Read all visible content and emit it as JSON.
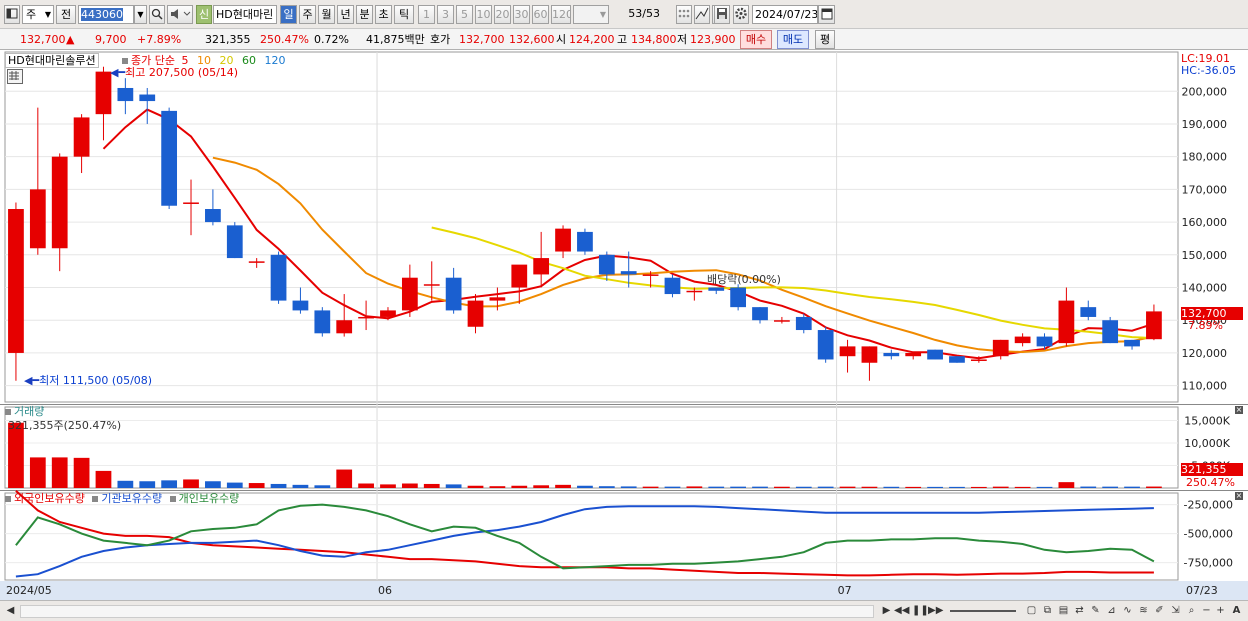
{
  "toolbar": {
    "market": "주",
    "prev": "전",
    "code": "443060",
    "new_badge": "신",
    "name": "HD현대마린",
    "periods": [
      "일",
      "주",
      "월",
      "년",
      "분",
      "초",
      "틱"
    ],
    "active_period": "일",
    "intervals": [
      "1",
      "3",
      "5",
      "10",
      "20",
      "30",
      "60",
      "120"
    ],
    "count": "53",
    "count_total": "/53",
    "date": "2024/07/23"
  },
  "quote": {
    "price": "132,700",
    "change": "9,700",
    "change_arrow": "▲",
    "change_pct": "+7.89%",
    "volume": "321,355",
    "volume_ratio": "250.47%",
    "turnover_pct": "0.72%",
    "amount": "41,875백만",
    "hoga_label": "호가",
    "ask": "132,700",
    "bid": "132,600",
    "open_label": "시",
    "open": "124,200",
    "high_label": "고",
    "high": "134,800",
    "low_label": "저",
    "low": "123,900",
    "buy_button": "매수",
    "sell_button": "매도",
    "eval_button": "평"
  },
  "chart": {
    "title": "HD현대마린솔루션",
    "ma_label": "종가 단순",
    "ma_periods": [
      {
        "label": "5",
        "color": "#e60000"
      },
      {
        "label": "10",
        "color": "#f08a00"
      },
      {
        "label": "20",
        "color": "#e6d800"
      },
      {
        "label": "60",
        "color": "#1a8a1a"
      },
      {
        "label": "120",
        "color": "#1a7ad0"
      }
    ],
    "lc": "LC:19.01",
    "hc": "HC:-36.05",
    "high_note": "최고 207,500 (05/14)",
    "low_note": "최저 111,500 (05/08)",
    "dividend_note": "배당락(0.00%)",
    "last_price_tag": "132,700",
    "last_pct_tag": "7.89%",
    "price_ticks": [
      "200,000",
      "190,000",
      "180,000",
      "170,000",
      "160,000",
      "150,000",
      "140,000",
      "130,000",
      "120,000",
      "110,000"
    ],
    "volume_title": "거래량",
    "volume_note": "321,355주(250.47%)",
    "volume_ticks": [
      "15,000K",
      "10,000K",
      "5,000K"
    ],
    "volume_tag": "321,355",
    "volume_pct_tag": "250.47%",
    "holding_legend": [
      {
        "label": "외국인보유수량",
        "color": "#e60000"
      },
      {
        "label": "기관보유수량",
        "color": "#1a50d0"
      },
      {
        "label": "개인보유수량",
        "color": "#2a8a3a"
      }
    ],
    "holding_ticks": [
      "-250,000",
      "-500,000",
      "-750,000"
    ],
    "x_labels": [
      "2024/05",
      "06",
      "07"
    ],
    "x_last_label": "07/23"
  },
  "colors": {
    "up": "#e60000",
    "down": "#1a5fd0",
    "ma5": "#e60000",
    "ma10": "#f08a00",
    "ma20": "#e6d800"
  },
  "chart_data": {
    "type": "candlestick",
    "price_ylim": [
      105000,
      212000
    ],
    "candles": [
      {
        "o": 120000,
        "h": 166000,
        "l": 111500,
        "c": 164000
      },
      {
        "o": 152000,
        "h": 195000,
        "l": 150000,
        "c": 170000
      },
      {
        "o": 152000,
        "h": 181000,
        "l": 145000,
        "c": 180000
      },
      {
        "o": 180000,
        "h": 193000,
        "l": 175000,
        "c": 192000
      },
      {
        "o": 193000,
        "h": 207500,
        "l": 185000,
        "c": 206000
      },
      {
        "o": 201000,
        "h": 204000,
        "l": 193000,
        "c": 197000
      },
      {
        "o": 199000,
        "h": 201000,
        "l": 190000,
        "c": 197000
      },
      {
        "o": 194000,
        "h": 195000,
        "l": 164000,
        "c": 165000
      },
      {
        "o": 166000,
        "h": 173000,
        "l": 156000,
        "c": 166000
      },
      {
        "o": 164000,
        "h": 170000,
        "l": 159000,
        "c": 160000
      },
      {
        "o": 159000,
        "h": 160000,
        "l": 149000,
        "c": 149000
      },
      {
        "o": 148000,
        "h": 149000,
        "l": 146000,
        "c": 148000
      },
      {
        "o": 150000,
        "h": 151000,
        "l": 135000,
        "c": 136000
      },
      {
        "o": 136000,
        "h": 140000,
        "l": 132000,
        "c": 133000
      },
      {
        "o": 133000,
        "h": 134000,
        "l": 125000,
        "c": 126000
      },
      {
        "o": 126000,
        "h": 138000,
        "l": 125000,
        "c": 130000
      },
      {
        "o": 131000,
        "h": 136000,
        "l": 127000,
        "c": 131000
      },
      {
        "o": 131000,
        "h": 134000,
        "l": 130000,
        "c": 133000
      },
      {
        "o": 133000,
        "h": 147000,
        "l": 131000,
        "c": 143000
      },
      {
        "o": 141000,
        "h": 148000,
        "l": 136000,
        "c": 141000
      },
      {
        "o": 143000,
        "h": 146000,
        "l": 132000,
        "c": 133000
      },
      {
        "o": 128000,
        "h": 138000,
        "l": 126000,
        "c": 136000
      },
      {
        "o": 136000,
        "h": 140000,
        "l": 133000,
        "c": 137000
      },
      {
        "o": 140000,
        "h": 145000,
        "l": 135000,
        "c": 147000
      },
      {
        "o": 144000,
        "h": 157000,
        "l": 140000,
        "c": 149000
      },
      {
        "o": 151000,
        "h": 159000,
        "l": 149000,
        "c": 158000
      },
      {
        "o": 157000,
        "h": 158000,
        "l": 150000,
        "c": 151000
      },
      {
        "o": 150000,
        "h": 151000,
        "l": 142000,
        "c": 144000
      },
      {
        "o": 145000,
        "h": 151000,
        "l": 140000,
        "c": 144000
      },
      {
        "o": 144000,
        "h": 145000,
        "l": 140000,
        "c": 144000
      },
      {
        "o": 143000,
        "h": 144000,
        "l": 137000,
        "c": 138000
      },
      {
        "o": 139000,
        "h": 140000,
        "l": 136000,
        "c": 139000
      },
      {
        "o": 140000,
        "h": 140000,
        "l": 138000,
        "c": 139000
      },
      {
        "o": 140000,
        "h": 141000,
        "l": 133000,
        "c": 134000
      },
      {
        "o": 134000,
        "h": 134000,
        "l": 129000,
        "c": 130000
      },
      {
        "o": 130000,
        "h": 131000,
        "l": 129000,
        "c": 130000
      },
      {
        "o": 131000,
        "h": 132000,
        "l": 126000,
        "c": 127000
      },
      {
        "o": 127000,
        "h": 128000,
        "l": 117000,
        "c": 118000
      },
      {
        "o": 119000,
        "h": 124000,
        "l": 114000,
        "c": 122000
      },
      {
        "o": 117000,
        "h": 122000,
        "l": 111500,
        "c": 122000
      },
      {
        "o": 120000,
        "h": 121000,
        "l": 118000,
        "c": 119000
      },
      {
        "o": 119000,
        "h": 120000,
        "l": 118000,
        "c": 120000
      },
      {
        "o": 121000,
        "h": 121000,
        "l": 118000,
        "c": 118000
      },
      {
        "o": 119000,
        "h": 119000,
        "l": 117000,
        "c": 117000
      },
      {
        "o": 118000,
        "h": 119000,
        "l": 117000,
        "c": 118000
      },
      {
        "o": 119000,
        "h": 124000,
        "l": 118000,
        "c": 124000
      },
      {
        "o": 123000,
        "h": 126000,
        "l": 122000,
        "c": 125000
      },
      {
        "o": 125000,
        "h": 126000,
        "l": 121000,
        "c": 122000
      },
      {
        "o": 123000,
        "h": 140000,
        "l": 122000,
        "c": 136000
      },
      {
        "o": 134000,
        "h": 136000,
        "l": 130000,
        "c": 131000
      },
      {
        "o": 130000,
        "h": 131000,
        "l": 123000,
        "c": 123000
      },
      {
        "o": 124000,
        "h": 124000,
        "l": 121000,
        "c": 122000
      },
      {
        "o": 124200,
        "h": 134800,
        "l": 123900,
        "c": 132700
      }
    ],
    "volume_ylim": [
      0,
      18000
    ],
    "volume_k": [
      14500,
      6800,
      6800,
      6700,
      3800,
      1600,
      1500,
      1700,
      1900,
      1500,
      1200,
      1100,
      900,
      700,
      600,
      4100,
      1000,
      800,
      1000,
      900,
      800,
      500,
      400,
      500,
      600,
      700,
      500,
      400,
      350,
      300,
      300,
      350,
      300,
      300,
      300,
      280,
      280,
      300,
      300,
      280,
      270,
      250,
      250,
      250,
      240,
      300,
      250,
      250,
      1300,
      320,
      300,
      300,
      321
    ],
    "holding_ylim": [
      -900000,
      -150000
    ],
    "foreign": [
      -130000,
      -300000,
      -400000,
      -450000,
      -500000,
      -520000,
      -520000,
      -530000,
      -580000,
      -600000,
      -610000,
      -620000,
      -630000,
      -640000,
      -650000,
      -660000,
      -680000,
      -700000,
      -720000,
      -720000,
      -730000,
      -740000,
      -760000,
      -780000,
      -790000,
      -790000,
      -790000,
      -790000,
      -800000,
      -800000,
      -810000,
      -820000,
      -830000,
      -840000,
      -840000,
      -845000,
      -850000,
      -855000,
      -860000,
      -860000,
      -855000,
      -850000,
      -850000,
      -855000,
      -850000,
      -845000,
      -845000,
      -840000,
      -830000,
      -830000,
      -835000,
      -835000,
      -835000
    ],
    "institution": [
      -870000,
      -850000,
      -780000,
      -700000,
      -650000,
      -620000,
      -600000,
      -590000,
      -580000,
      -580000,
      -570000,
      -560000,
      -600000,
      -650000,
      -690000,
      -700000,
      -660000,
      -640000,
      -600000,
      -560000,
      -520000,
      -490000,
      -470000,
      -440000,
      -400000,
      -340000,
      -290000,
      -270000,
      -265000,
      -265000,
      -265000,
      -265000,
      -270000,
      -280000,
      -290000,
      -300000,
      -310000,
      -320000,
      -320000,
      -320000,
      -320000,
      -320000,
      -320000,
      -320000,
      -320000,
      -315000,
      -310000,
      -305000,
      -300000,
      -295000,
      -290000,
      -285000,
      -280000
    ],
    "individual": [
      -600000,
      -360000,
      -420000,
      -500000,
      -560000,
      -580000,
      -600000,
      -560000,
      -480000,
      -460000,
      -450000,
      -420000,
      -300000,
      -260000,
      -250000,
      -270000,
      -300000,
      -350000,
      -420000,
      -480000,
      -440000,
      -450000,
      -520000,
      -580000,
      -700000,
      -800000,
      -790000,
      -780000,
      -770000,
      -770000,
      -760000,
      -760000,
      -750000,
      -740000,
      -720000,
      -700000,
      -660000,
      -580000,
      -560000,
      -560000,
      -550000,
      -550000,
      -540000,
      -540000,
      -560000,
      -570000,
      -590000,
      -640000,
      -660000,
      -650000,
      -630000,
      -640000,
      -740000
    ]
  }
}
